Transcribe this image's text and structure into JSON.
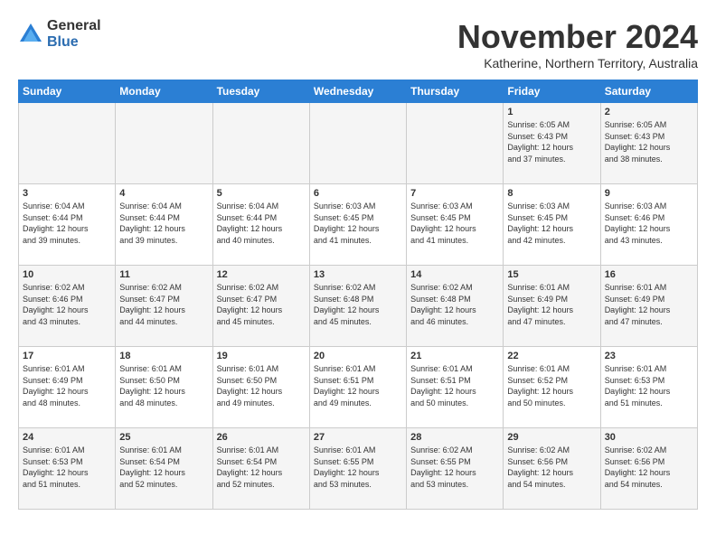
{
  "logo": {
    "general": "General",
    "blue": "Blue"
  },
  "title": "November 2024",
  "subtitle": "Katherine, Northern Territory, Australia",
  "days_header": [
    "Sunday",
    "Monday",
    "Tuesday",
    "Wednesday",
    "Thursday",
    "Friday",
    "Saturday"
  ],
  "weeks": [
    [
      {
        "day": "",
        "info": ""
      },
      {
        "day": "",
        "info": ""
      },
      {
        "day": "",
        "info": ""
      },
      {
        "day": "",
        "info": ""
      },
      {
        "day": "",
        "info": ""
      },
      {
        "day": "1",
        "info": "Sunrise: 6:05 AM\nSunset: 6:43 PM\nDaylight: 12 hours\nand 37 minutes."
      },
      {
        "day": "2",
        "info": "Sunrise: 6:05 AM\nSunset: 6:43 PM\nDaylight: 12 hours\nand 38 minutes."
      }
    ],
    [
      {
        "day": "3",
        "info": "Sunrise: 6:04 AM\nSunset: 6:44 PM\nDaylight: 12 hours\nand 39 minutes."
      },
      {
        "day": "4",
        "info": "Sunrise: 6:04 AM\nSunset: 6:44 PM\nDaylight: 12 hours\nand 39 minutes."
      },
      {
        "day": "5",
        "info": "Sunrise: 6:04 AM\nSunset: 6:44 PM\nDaylight: 12 hours\nand 40 minutes."
      },
      {
        "day": "6",
        "info": "Sunrise: 6:03 AM\nSunset: 6:45 PM\nDaylight: 12 hours\nand 41 minutes."
      },
      {
        "day": "7",
        "info": "Sunrise: 6:03 AM\nSunset: 6:45 PM\nDaylight: 12 hours\nand 41 minutes."
      },
      {
        "day": "8",
        "info": "Sunrise: 6:03 AM\nSunset: 6:45 PM\nDaylight: 12 hours\nand 42 minutes."
      },
      {
        "day": "9",
        "info": "Sunrise: 6:03 AM\nSunset: 6:46 PM\nDaylight: 12 hours\nand 43 minutes."
      }
    ],
    [
      {
        "day": "10",
        "info": "Sunrise: 6:02 AM\nSunset: 6:46 PM\nDaylight: 12 hours\nand 43 minutes."
      },
      {
        "day": "11",
        "info": "Sunrise: 6:02 AM\nSunset: 6:47 PM\nDaylight: 12 hours\nand 44 minutes."
      },
      {
        "day": "12",
        "info": "Sunrise: 6:02 AM\nSunset: 6:47 PM\nDaylight: 12 hours\nand 45 minutes."
      },
      {
        "day": "13",
        "info": "Sunrise: 6:02 AM\nSunset: 6:48 PM\nDaylight: 12 hours\nand 45 minutes."
      },
      {
        "day": "14",
        "info": "Sunrise: 6:02 AM\nSunset: 6:48 PM\nDaylight: 12 hours\nand 46 minutes."
      },
      {
        "day": "15",
        "info": "Sunrise: 6:01 AM\nSunset: 6:49 PM\nDaylight: 12 hours\nand 47 minutes."
      },
      {
        "day": "16",
        "info": "Sunrise: 6:01 AM\nSunset: 6:49 PM\nDaylight: 12 hours\nand 47 minutes."
      }
    ],
    [
      {
        "day": "17",
        "info": "Sunrise: 6:01 AM\nSunset: 6:49 PM\nDaylight: 12 hours\nand 48 minutes."
      },
      {
        "day": "18",
        "info": "Sunrise: 6:01 AM\nSunset: 6:50 PM\nDaylight: 12 hours\nand 48 minutes."
      },
      {
        "day": "19",
        "info": "Sunrise: 6:01 AM\nSunset: 6:50 PM\nDaylight: 12 hours\nand 49 minutes."
      },
      {
        "day": "20",
        "info": "Sunrise: 6:01 AM\nSunset: 6:51 PM\nDaylight: 12 hours\nand 49 minutes."
      },
      {
        "day": "21",
        "info": "Sunrise: 6:01 AM\nSunset: 6:51 PM\nDaylight: 12 hours\nand 50 minutes."
      },
      {
        "day": "22",
        "info": "Sunrise: 6:01 AM\nSunset: 6:52 PM\nDaylight: 12 hours\nand 50 minutes."
      },
      {
        "day": "23",
        "info": "Sunrise: 6:01 AM\nSunset: 6:53 PM\nDaylight: 12 hours\nand 51 minutes."
      }
    ],
    [
      {
        "day": "24",
        "info": "Sunrise: 6:01 AM\nSunset: 6:53 PM\nDaylight: 12 hours\nand 51 minutes."
      },
      {
        "day": "25",
        "info": "Sunrise: 6:01 AM\nSunset: 6:54 PM\nDaylight: 12 hours\nand 52 minutes."
      },
      {
        "day": "26",
        "info": "Sunrise: 6:01 AM\nSunset: 6:54 PM\nDaylight: 12 hours\nand 52 minutes."
      },
      {
        "day": "27",
        "info": "Sunrise: 6:01 AM\nSunset: 6:55 PM\nDaylight: 12 hours\nand 53 minutes."
      },
      {
        "day": "28",
        "info": "Sunrise: 6:02 AM\nSunset: 6:55 PM\nDaylight: 12 hours\nand 53 minutes."
      },
      {
        "day": "29",
        "info": "Sunrise: 6:02 AM\nSunset: 6:56 PM\nDaylight: 12 hours\nand 54 minutes."
      },
      {
        "day": "30",
        "info": "Sunrise: 6:02 AM\nSunset: 6:56 PM\nDaylight: 12 hours\nand 54 minutes."
      }
    ]
  ]
}
